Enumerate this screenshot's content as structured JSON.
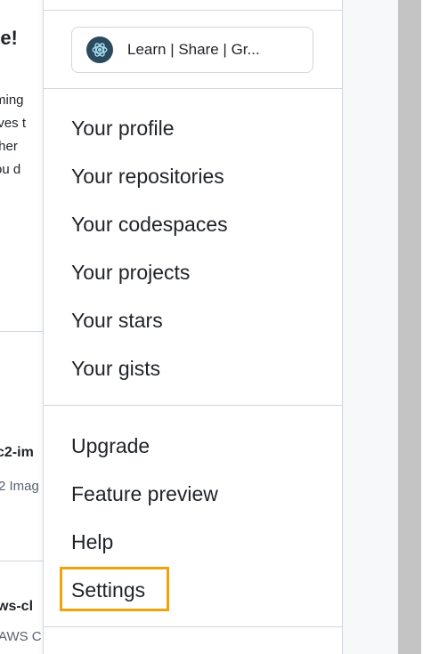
{
  "background_page": {
    "heading": "te!",
    "paragraph_lines": [
      "ming",
      "ives t",
      "ther",
      "ou d"
    ],
    "repo_1": {
      "title": "c2-im",
      "subtitle": "2 Imag"
    },
    "repo_2": {
      "title": "ws-cl",
      "subtitle": "AWS C"
    }
  },
  "status_button": {
    "label": "Learn | Share | Gr...",
    "icon": "openai-icon"
  },
  "menu": {
    "section_1": [
      {
        "label": "Your profile"
      },
      {
        "label": "Your repositories"
      },
      {
        "label": "Your codespaces"
      },
      {
        "label": "Your projects"
      },
      {
        "label": "Your stars"
      },
      {
        "label": "Your gists"
      }
    ],
    "section_2": [
      {
        "label": "Upgrade"
      },
      {
        "label": "Feature preview"
      },
      {
        "label": "Help"
      },
      {
        "label": "Settings"
      }
    ]
  },
  "colors": {
    "highlight": "#f0a30a",
    "border": "#d0d7de",
    "text": "#1f2328",
    "muted_text": "#59636e",
    "scrollbar": "#c4c4c4"
  }
}
